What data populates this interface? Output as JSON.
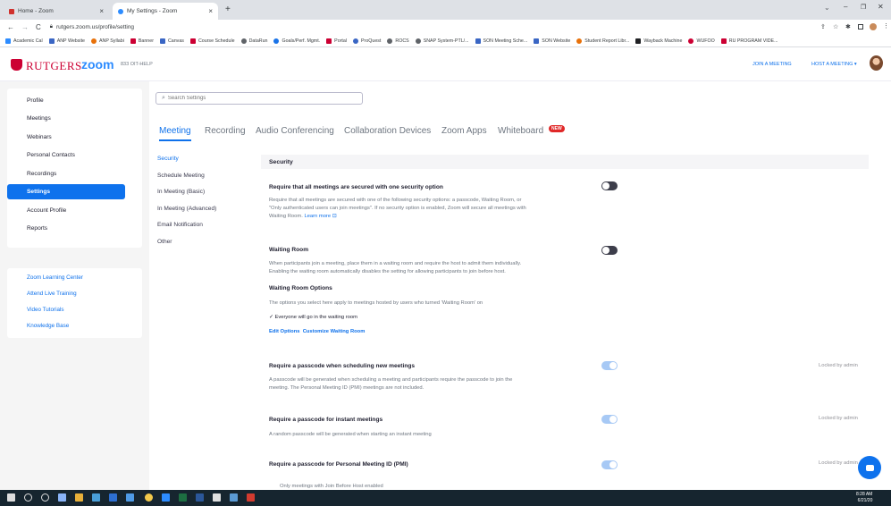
{
  "browser": {
    "tabs": [
      {
        "title": "Home - Zoom",
        "active": false
      },
      {
        "title": "My Settings - Zoom",
        "active": true
      }
    ],
    "url": "rutgers.zoom.us/profile/setting",
    "bookmarks": [
      "Academic Cal",
      "ANP Website",
      "ANP Syllabi",
      "Banner",
      "Canvas",
      "Course Schedule",
      "DataRun",
      "Goals/Perf. Mgmt.",
      "Portal",
      "ProQuest",
      "ROCS",
      "SNAP System-PTL/...",
      "SON Meeting Sche...",
      "SON Website",
      "Student Report Libr...",
      "Wayback Machine",
      "WUFOO",
      "RU PROGRAM VIDE..."
    ]
  },
  "header": {
    "brand": "RUTGERS",
    "zoom": "zoom",
    "help": "833 OIT-HELP",
    "join": "JOIN A MEETING",
    "host": "HOST A MEETING ▾"
  },
  "sidebar": {
    "items": [
      "Profile",
      "Meetings",
      "Webinars",
      "Personal Contacts",
      "Recordings",
      "Settings",
      "Account Profile",
      "Reports"
    ],
    "active": "Settings",
    "links": [
      "Zoom Learning Center",
      "Attend Live Training",
      "Video Tutorials",
      "Knowledge Base"
    ]
  },
  "search": {
    "placeholder": "Search Settings"
  },
  "tabs": [
    "Meeting",
    "Recording",
    "Audio Conferencing",
    "Collaboration Devices",
    "Zoom Apps",
    "Whiteboard"
  ],
  "new_badge": "NEW",
  "subnav": [
    "Security",
    "Schedule Meeting",
    "In Meeting (Basic)",
    "In Meeting (Advanced)",
    "Email Notification",
    "Other"
  ],
  "section_header": "Security",
  "settings": {
    "secure": {
      "title": "Require that all meetings are secured with one security option",
      "desc1": "Require that all meetings are secured with one of the following security options: a passcode, Waiting Room, or",
      "desc2": "\"Only authenticated users can join meetings\". If no security option is enabled, Zoom will secure all meetings with",
      "desc3": "Waiting Room.",
      "learn_more": "Learn more"
    },
    "waiting": {
      "title": "Waiting Room",
      "desc1": "When participants join a meeting, place them in a waiting room and require the host to admit them individually.",
      "desc2": "Enabling the waiting room automatically disables the setting for allowing participants to join before host.",
      "options_title": "Waiting Room Options",
      "options_desc": "The options you select here apply to meetings hosted by users who turned 'Waiting Room' on",
      "check": "Everyone will go in the waiting room",
      "edit": "Edit Options",
      "customize": "Customize Waiting Room"
    },
    "pass_sched": {
      "title": "Require a passcode when scheduling new meetings",
      "desc1": "A passcode will be generated when scheduling a meeting and participants require the passcode to join the",
      "desc2": "meeting. The Personal Meeting ID (PMI) meetings are not included."
    },
    "pass_instant": {
      "title": "Require a passcode for instant meetings",
      "desc1": "A random passcode will be generated when starting an instant meeting"
    },
    "pass_pmi": {
      "title": "Require a passcode for Personal Meeting ID (PMI)",
      "desc1": "Only meetings with Join Before Host enabled"
    },
    "locked": "Locked by admin"
  },
  "taskbar": {
    "time": "8:28 AM",
    "date": "6/21/20"
  }
}
